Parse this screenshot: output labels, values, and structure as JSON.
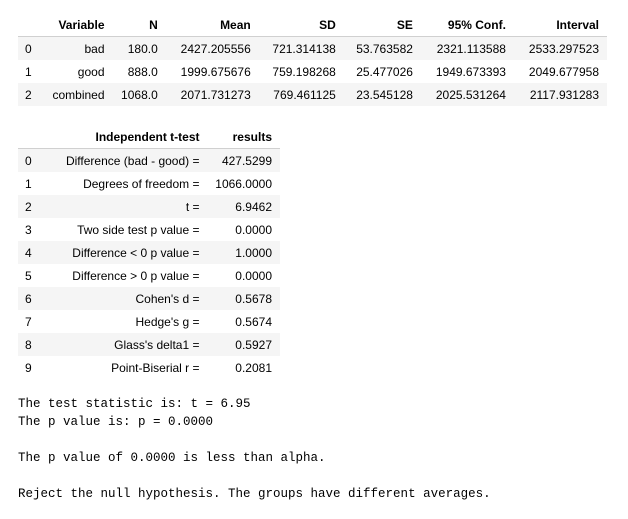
{
  "table1": {
    "headers": [
      "",
      "Variable",
      "N",
      "Mean",
      "SD",
      "SE",
      "95% Conf.",
      "Interval"
    ],
    "rows": [
      [
        "0",
        "bad",
        "180.0",
        "2427.205556",
        "721.314138",
        "53.763582",
        "2321.113588",
        "2533.297523"
      ],
      [
        "1",
        "good",
        "888.0",
        "1999.675676",
        "759.198268",
        "25.477026",
        "1949.673393",
        "2049.677958"
      ],
      [
        "2",
        "combined",
        "1068.0",
        "2071.731273",
        "769.461125",
        "23.545128",
        "2025.531264",
        "2117.931283"
      ]
    ]
  },
  "table2": {
    "headers": [
      "",
      "Independent t-test",
      "results"
    ],
    "rows": [
      [
        "0",
        "Difference (bad - good) =",
        "427.5299"
      ],
      [
        "1",
        "Degrees of freedom =",
        "1066.0000"
      ],
      [
        "2",
        "t =",
        "6.9462"
      ],
      [
        "3",
        "Two side test p value =",
        "0.0000"
      ],
      [
        "4",
        "Difference < 0 p value =",
        "1.0000"
      ],
      [
        "5",
        "Difference > 0 p value =",
        "0.0000"
      ],
      [
        "6",
        "Cohen's d =",
        "0.5678"
      ],
      [
        "7",
        "Hedge's g =",
        "0.5674"
      ],
      [
        "8",
        "Glass's delta1 =",
        "0.5927"
      ],
      [
        "9",
        "Point-Biserial r =",
        "0.2081"
      ]
    ]
  },
  "output": {
    "line1": "The test statistic is: t = 6.95",
    "line2": "The p value is: p = 0.0000",
    "line3": "The p value of 0.0000 is less than alpha.",
    "line4": "Reject the null hypothesis. The groups have different averages."
  }
}
